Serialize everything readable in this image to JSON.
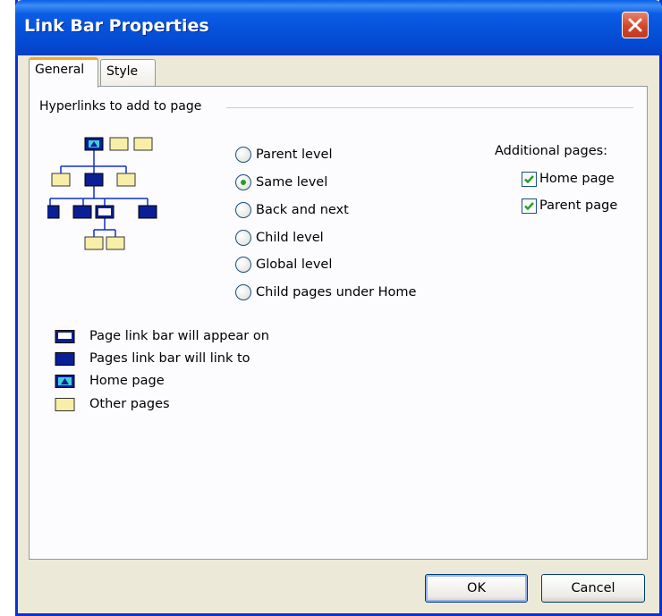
{
  "window": {
    "title": "Link Bar Properties"
  },
  "tabs": [
    {
      "label": "General",
      "active": true
    },
    {
      "label": "Style",
      "active": false
    }
  ],
  "group": {
    "label": "Hyperlinks to add to page"
  },
  "radios": [
    {
      "label": "Parent level",
      "checked": false
    },
    {
      "label": "Same level",
      "checked": true
    },
    {
      "label": "Back and next",
      "checked": false
    },
    {
      "label": "Child level",
      "checked": false
    },
    {
      "label": "Global level",
      "checked": false
    },
    {
      "label": "Child pages under Home",
      "checked": false
    }
  ],
  "additional": {
    "label": "Additional pages:",
    "items": [
      {
        "label": "Home page",
        "checked": true
      },
      {
        "label": "Parent page",
        "checked": true
      }
    ]
  },
  "legend": [
    {
      "label": "Page link bar will appear on",
      "icon": "current-page-icon"
    },
    {
      "label": "Pages link bar will link to",
      "icon": "linked-page-icon"
    },
    {
      "label": "Home page",
      "icon": "home-page-icon"
    },
    {
      "label": "Other pages",
      "icon": "other-page-icon"
    }
  ],
  "buttons": {
    "ok": "OK",
    "cancel": "Cancel"
  },
  "colors": {
    "title_bar": "#0550d8",
    "linked_page": "#0a1e96",
    "other_page": "#f7efa8",
    "home_page": "#3ed2d8",
    "tab_highlight": "#f7a531",
    "check_mark": "#21a121"
  }
}
